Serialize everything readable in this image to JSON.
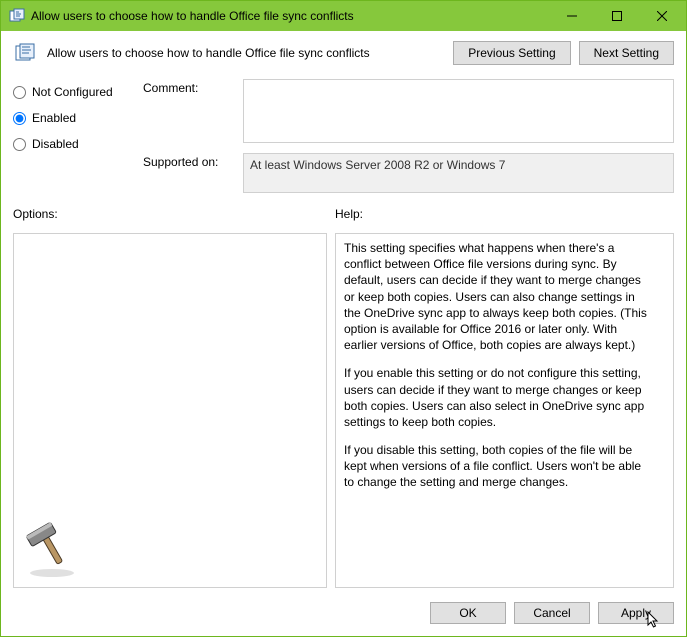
{
  "window": {
    "title": "Allow users to choose how to handle Office file sync conflicts"
  },
  "header": {
    "title": "Allow users to choose how to handle Office file sync conflicts",
    "prev_label": "Previous Setting",
    "next_label": "Next Setting"
  },
  "radios": {
    "not_configured": "Not Configured",
    "enabled": "Enabled",
    "disabled": "Disabled",
    "selected": "enabled"
  },
  "fields": {
    "comment_label": "Comment:",
    "comment_value": "",
    "supported_label": "Supported on:",
    "supported_value": "At least Windows Server 2008 R2 or Windows 7"
  },
  "sections": {
    "options_label": "Options:",
    "help_label": "Help:"
  },
  "help": {
    "p1": "This setting specifies what happens when there's a conflict between Office file versions during sync. By default, users can decide if they want to merge changes or keep both copies. Users can also change settings in the OneDrive sync app to always keep both copies. (This option is available for Office 2016 or later only. With earlier versions of Office, both copies are always kept.)",
    "p2": "If you enable this setting or do not configure this setting, users can decide if they want to merge changes or keep both copies. Users can also select in OneDrive sync app settings to keep both copies.",
    "p3": "If you disable this setting, both copies of the file will be kept when versions of a file conflict. Users won't be able to change the setting and merge changes."
  },
  "footer": {
    "ok": "OK",
    "cancel": "Cancel",
    "apply": "Apply"
  }
}
